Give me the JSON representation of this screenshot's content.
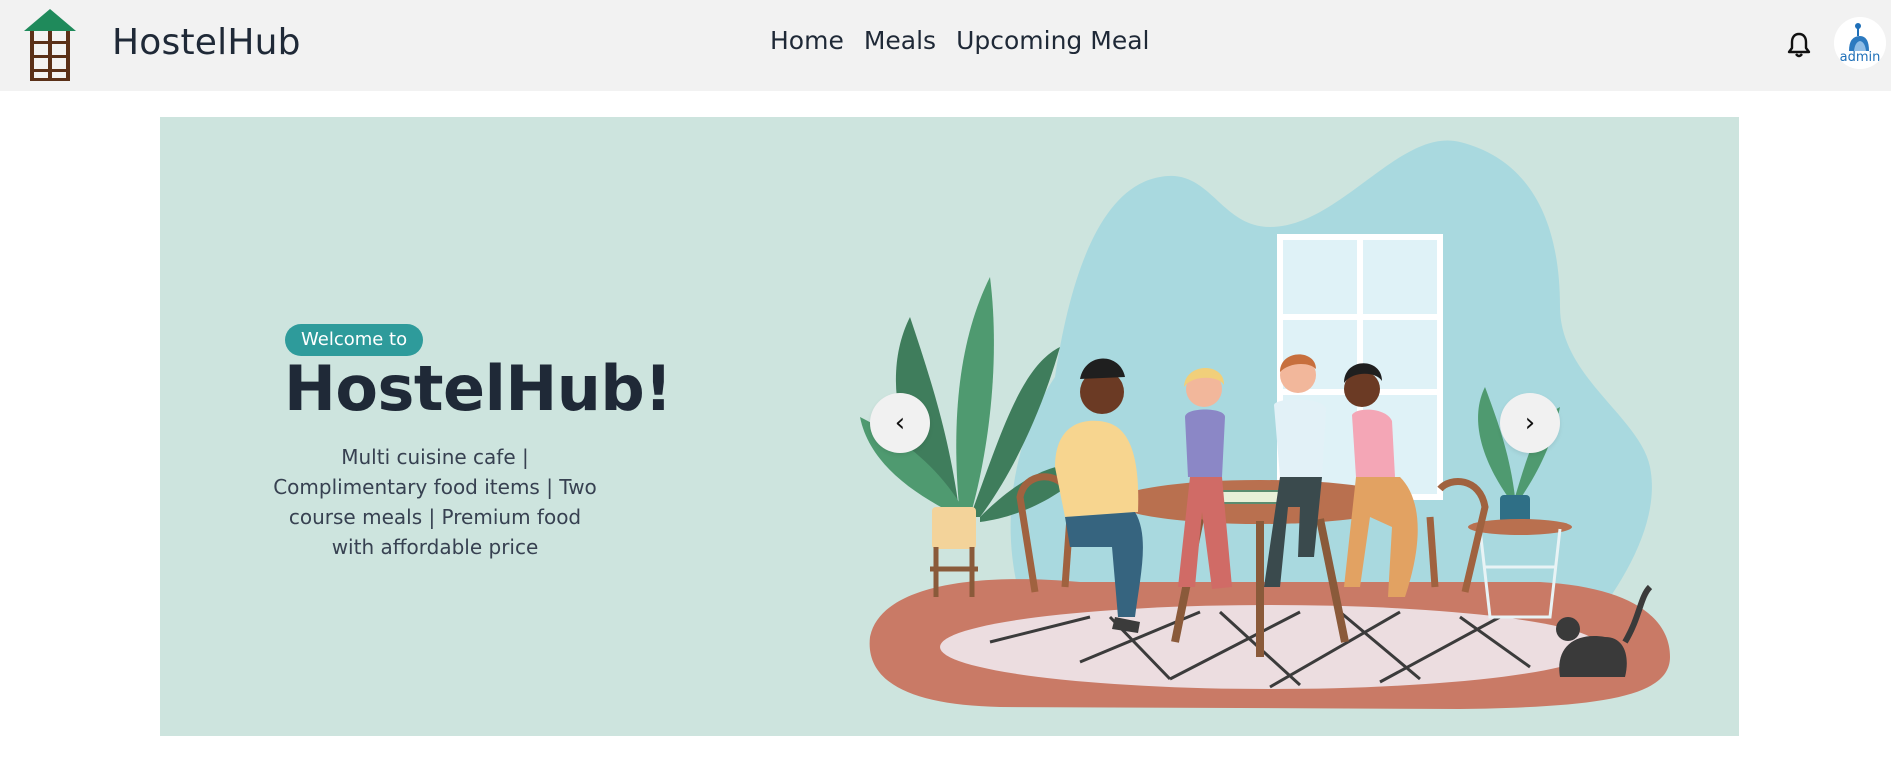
{
  "app": {
    "brand": "HostelHub"
  },
  "nav": {
    "links": [
      "Home",
      "Meals",
      "Upcoming Meal"
    ]
  },
  "header": {
    "avatar_label": "admin"
  },
  "hero": {
    "badge": "Welcome to",
    "title": "HostelHub!",
    "description": "Multi cuisine cafe | Complimentary food items | Two course meals | Premium food with affordable price",
    "prev_symbol": "‹",
    "next_symbol": "›"
  },
  "colors": {
    "nav_bg": "#f2f2f2",
    "hero_bg": "#cde4de",
    "badge": "#2e9b9b",
    "logo_roof": "#1f8a5b",
    "logo_frame": "#5a3018"
  },
  "icons": [
    "hostel-logo-icon",
    "bell-icon",
    "user-avatar-icon",
    "chevron-left-icon",
    "chevron-right-icon"
  ]
}
